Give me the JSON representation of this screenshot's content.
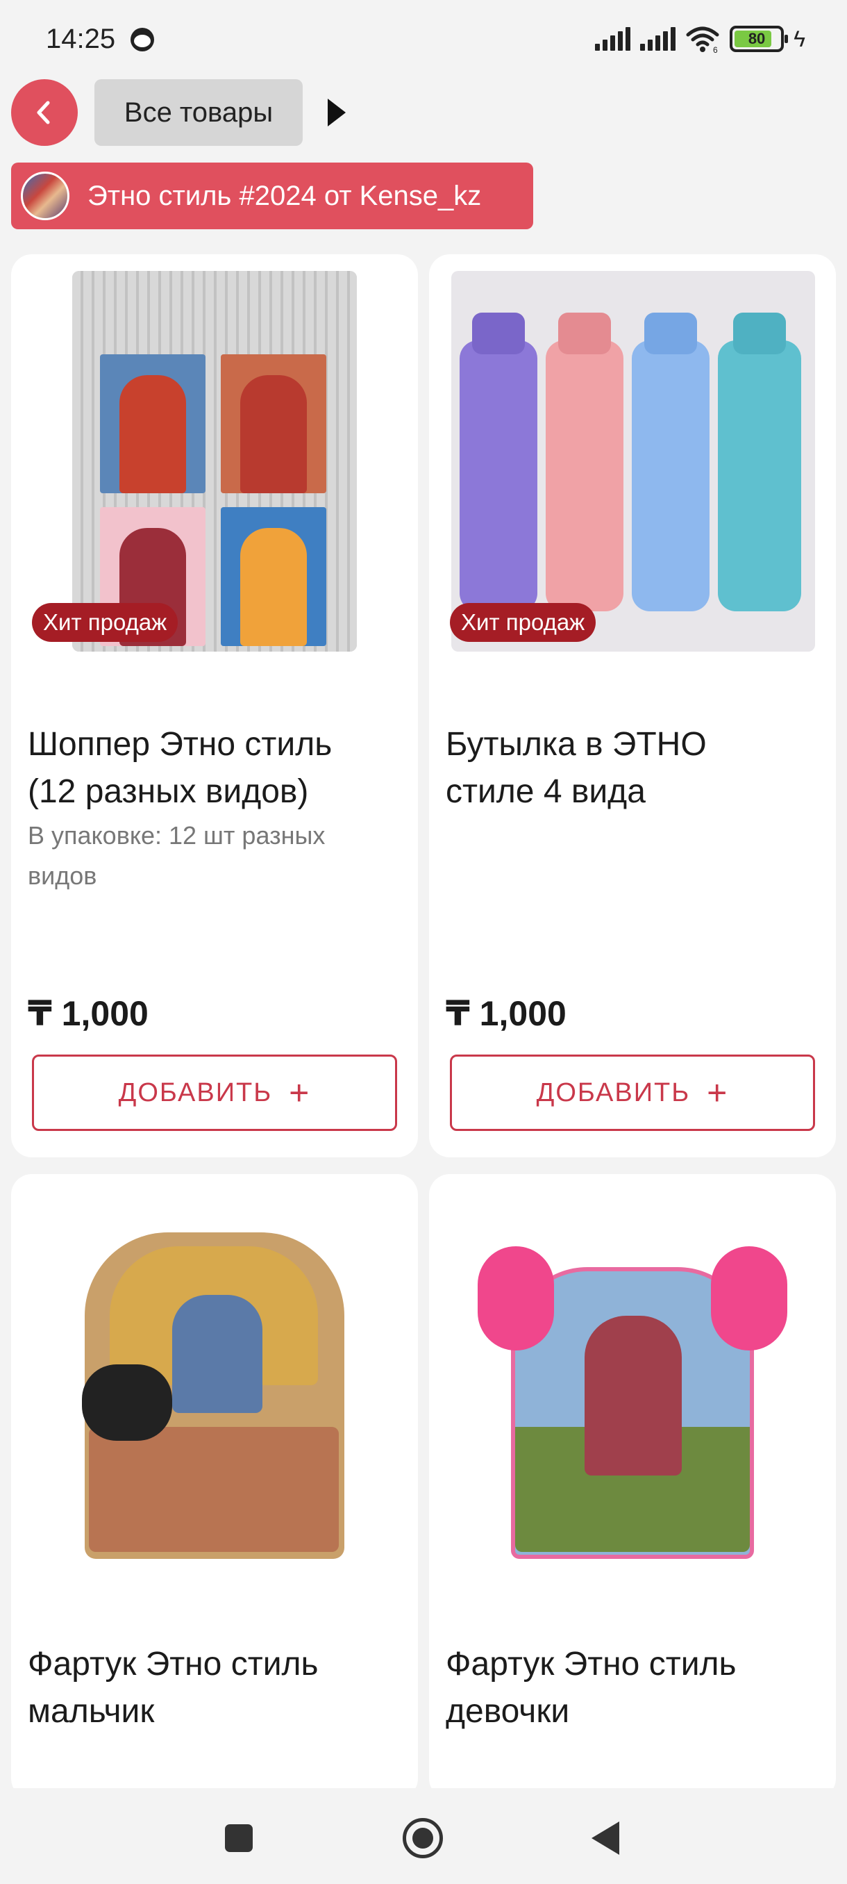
{
  "status_bar": {
    "time": "14:25",
    "battery": "80",
    "network": "6"
  },
  "header": {
    "back_icon": "chevron-left-icon",
    "all_products_label": "Все товары",
    "play_icon": "play-icon"
  },
  "collection": {
    "label": "Этно стиль #2024 от Kense_kz"
  },
  "products": [
    {
      "badge": "Хит продаж",
      "title_line1": "Шоппер Этно стиль",
      "title_line2": "(12 разных видов)",
      "desc_line1": "В упаковке: 12 шт разных",
      "desc_line2": "видов",
      "price": "₸ 1,000",
      "add_label": "ДОБАВИТЬ",
      "add_icon": "+"
    },
    {
      "badge": "Хит продаж",
      "title_line1": "Бутылка в ЭТНО",
      "title_line2": "стиле 4 вида",
      "price": "₸ 1,000",
      "add_label": "ДОБАВИТЬ",
      "add_icon": "+"
    },
    {
      "title_line1": "Фартук Этно стиль",
      "title_line2": "мальчик"
    },
    {
      "title_line1": "Фартук Этно стиль",
      "title_line2": "девочки"
    }
  ],
  "colors": {
    "accent": "#e0505e",
    "badge": "#a51d25",
    "button_border": "#c9384a",
    "background": "#f3f3f3"
  },
  "nav": {
    "recents_icon": "square-icon",
    "home_icon": "circle-home-icon",
    "back_icon": "triangle-back-icon"
  }
}
